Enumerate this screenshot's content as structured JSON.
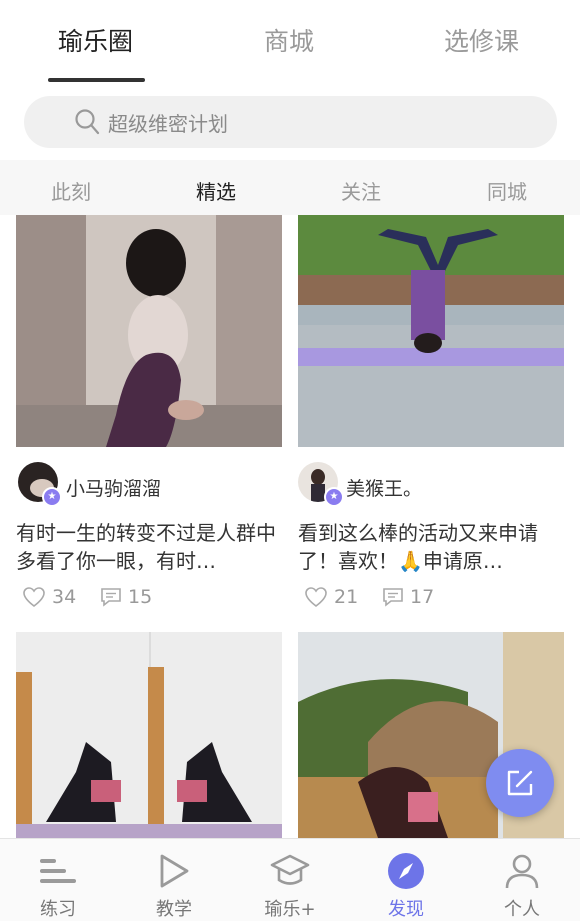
{
  "top_tabs": [
    "瑜乐圈",
    "商城",
    "选修课"
  ],
  "search": {
    "placeholder": "超级维密计划"
  },
  "sub_tabs": [
    "此刻",
    "精选",
    "关注",
    "同城"
  ],
  "cards": [
    {
      "user": "小马驹溜溜",
      "text": "有时一生的转变不过是人群中多看了你一眼，有时…",
      "likes": "34",
      "comments": "15"
    },
    {
      "user": "美猴王。",
      "text": "看到这么棒的活动又来申请了！喜欢！🙏申请原…",
      "likes": "21",
      "comments": "17"
    }
  ],
  "bottom_nav": [
    "练习",
    "教学",
    "瑜乐+",
    "发现",
    "个人"
  ],
  "colors": {
    "accent": "#6d74e8",
    "fab": "#7f8cf0",
    "badge": "#8a7cf0"
  }
}
